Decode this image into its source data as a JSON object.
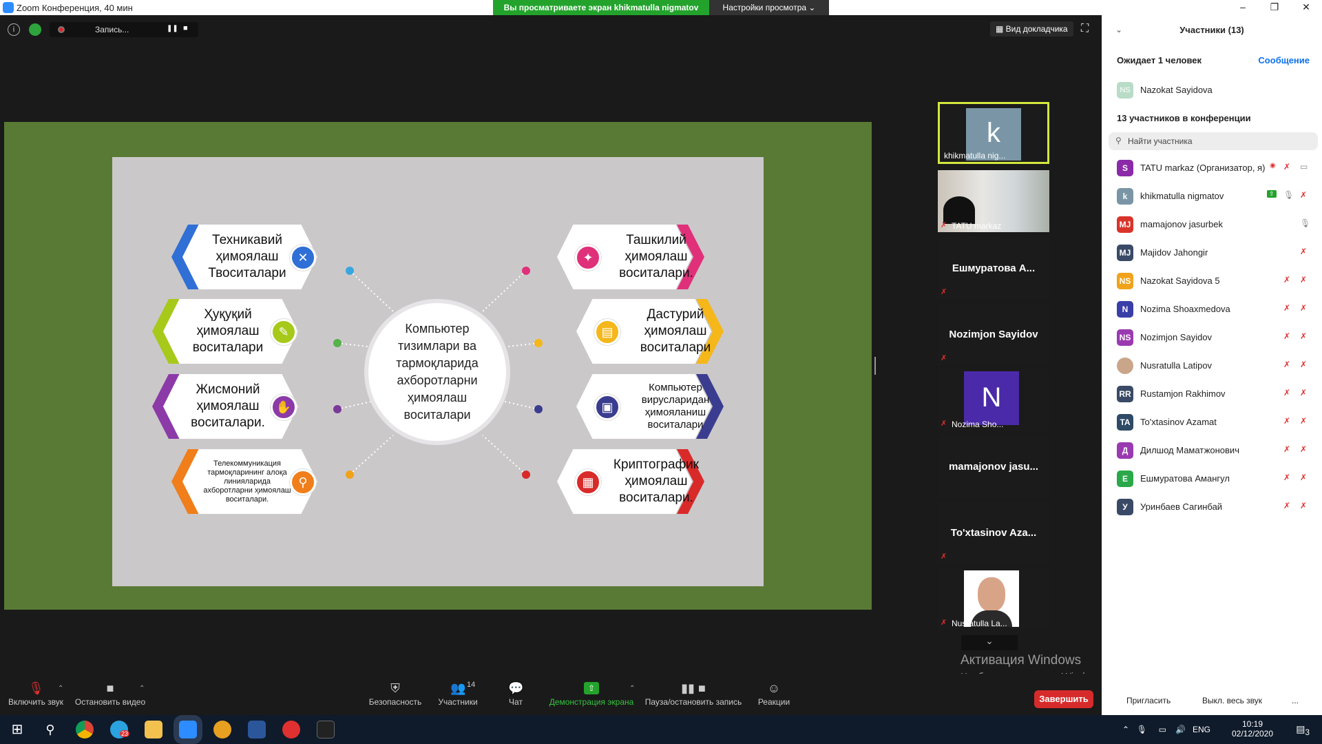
{
  "window": {
    "title": "Zoom Конференция, 40 мин",
    "minimize": "–",
    "restore": "❐",
    "close": "✕"
  },
  "banner": {
    "message": "Вы просматриваете экран khikmatulla nigmatov",
    "options": "Настройки просмотра ⌄"
  },
  "recording": {
    "status": "Запись...",
    "pause": "❚❚",
    "stop": "■"
  },
  "view": {
    "speaker_view": "Вид докладчика",
    "fullscreen": "⛶"
  },
  "slide": {
    "center": "Компьютер тизимлари ва тармоқларида ахборотларни ҳимоялаш воситалари",
    "cards": [
      {
        "label": "Техникавий ҳимоялаш Твоситалари",
        "color": "#2f6fd6",
        "icon": "wrench-icon",
        "glyph": "✕"
      },
      {
        "label": "Ҳуқуқий ҳимоялаш воситалари",
        "color": "#a6c91a",
        "icon": "idea-icon",
        "glyph": "✎"
      },
      {
        "label": "Жисмоний ҳимоялаш воситалари.",
        "color": "#8b3aa8",
        "icon": "hand-icon",
        "glyph": "✋"
      },
      {
        "label": "Телекоммуникация тармоқларининг алоқа линияларида ахборотларни ҳимоялаш воситалари.",
        "color": "#f07e1a",
        "icon": "location-icon",
        "glyph": "⚲"
      },
      {
        "label": "Ташкилий ҳимоялаш воситалари.",
        "color": "#e0307a",
        "icon": "bulb-icon",
        "glyph": "✦"
      },
      {
        "label": "Дастурий ҳимоялаш воситалари",
        "color": "#f5b719",
        "icon": "software-icon",
        "glyph": "▤"
      },
      {
        "label": "Компьютер вирусларидан ҳимояланиш воситалари",
        "color": "#3a3d8f",
        "icon": "briefcase-icon",
        "glyph": "▣"
      },
      {
        "label": "Криптографик ҳимоялаш воситалари.",
        "color": "#d92a2a",
        "icon": "shield-icon",
        "glyph": "▦"
      }
    ],
    "dot_colors": [
      "#39a6e0",
      "#56b24a",
      "#7a3a9a",
      "#f0a21a",
      "#e0307a",
      "#f5b719",
      "#3a3d8f",
      "#d92a2a"
    ]
  },
  "thumbnails": [
    {
      "name": "khikmatulla nig...",
      "avatar": "k",
      "avatar_color": "#7a96a6",
      "muted": false
    },
    {
      "name": "TATU markaz",
      "muted": true,
      "video": true
    },
    {
      "name": "Ешмуратова А...",
      "big": true,
      "muted": true
    },
    {
      "name": "Nozimjon Sayidov",
      "big": true,
      "muted": true
    },
    {
      "name": "Nozima Sho...",
      "avatar": "N",
      "avatar_color": "#4a2aa8",
      "muted": true
    },
    {
      "name": "mamajonov jasu...",
      "big": true,
      "muted": false
    },
    {
      "name": "To'xtasinov Aza...",
      "big": true,
      "muted": true
    },
    {
      "name": "Nusratulla La...",
      "muted": true,
      "photo": true
    }
  ],
  "watermark": {
    "line1": "Активация Windows",
    "line2": "Чтобы активировать Windows, перейдите в раздел \"Параметры\"."
  },
  "toolbar": {
    "unmute": "Включить звук",
    "video": "Остановить видео",
    "security": "Безопасность",
    "participants": "Участники",
    "participants_count": "14",
    "chat": "Чат",
    "share": "Демонстрация экрана",
    "pause_record": "Пауза/остановить запись",
    "reactions": "Реакции",
    "end": "Завершить"
  },
  "panel": {
    "title": "Участники (13)",
    "waiting_title": "Ожидает 1 человек",
    "message_link": "Сообщение",
    "waiting": [
      {
        "name": "Nazokat Sayidova",
        "initials": "NS",
        "color": "#b8dcc7"
      }
    ],
    "in_meeting_title": "13 участников в конференции",
    "search_placeholder": "Найти участника",
    "participants": [
      {
        "name": "TATU markaz (Организатор, я)",
        "initials": "S",
        "color": "#8a2aa8",
        "mic": "off",
        "cam": "on",
        "rec": true
      },
      {
        "name": "khikmatulla nigmatov",
        "initials": "k",
        "color": "#7a96a6",
        "mic": "on",
        "cam": "off",
        "share": true
      },
      {
        "name": "mamajonov jasurbek",
        "initials": "MJ",
        "color": "#d9342b",
        "mic": "on",
        "cam": "none"
      },
      {
        "name": "Majidov Jahongir",
        "initials": "MJ",
        "color": "#3a4a66",
        "mic": "off",
        "cam": "none"
      },
      {
        "name": "Nazokat Sayidova 5",
        "initials": "NS",
        "color": "#f0a21a",
        "mic": "off",
        "cam": "off"
      },
      {
        "name": "Nozima Shoaxmedova",
        "initials": "N",
        "color": "#3a3fa8",
        "mic": "off",
        "cam": "off"
      },
      {
        "name": "Nozimjon Sayidov",
        "initials": "NS",
        "color": "#9a3ab0",
        "mic": "off",
        "cam": "off"
      },
      {
        "name": "Nusratulla Latipov",
        "initials": "",
        "color": "#c9a58a",
        "mic": "off",
        "cam": "off",
        "photo": true
      },
      {
        "name": "Rustamjon Rakhimov",
        "initials": "RR",
        "color": "#3a4a66",
        "mic": "off",
        "cam": "off"
      },
      {
        "name": "To'xtasinov Azamat",
        "initials": "TA",
        "color": "#2e4a66",
        "mic": "off",
        "cam": "off"
      },
      {
        "name": "Дилшод Маматжонович",
        "initials": "Д",
        "color": "#9a3ab0",
        "mic": "off",
        "cam": "off"
      },
      {
        "name": "Ешмуратова Амангул",
        "initials": "Е",
        "color": "#2aa84a",
        "mic": "off",
        "cam": "off"
      },
      {
        "name": "Уринбаев Сагинбай",
        "initials": "У",
        "color": "#3a4a66",
        "mic": "off",
        "cam": "off"
      }
    ],
    "invite": "Пригласить",
    "mute_all": "Выкл. весь звук",
    "more": "..."
  },
  "taskbar": {
    "apps": [
      "windows-start-icon",
      "search-icon",
      "chrome-icon",
      "telegram-icon",
      "file-explorer-icon",
      "zoom-icon",
      "autocad-icon",
      "word-icon",
      "yandex-icon",
      "terminal-icon"
    ],
    "telegram_badge": "23",
    "lang": "ENG",
    "time": "10:19",
    "date": "02/12/2020",
    "notifications": "3"
  }
}
